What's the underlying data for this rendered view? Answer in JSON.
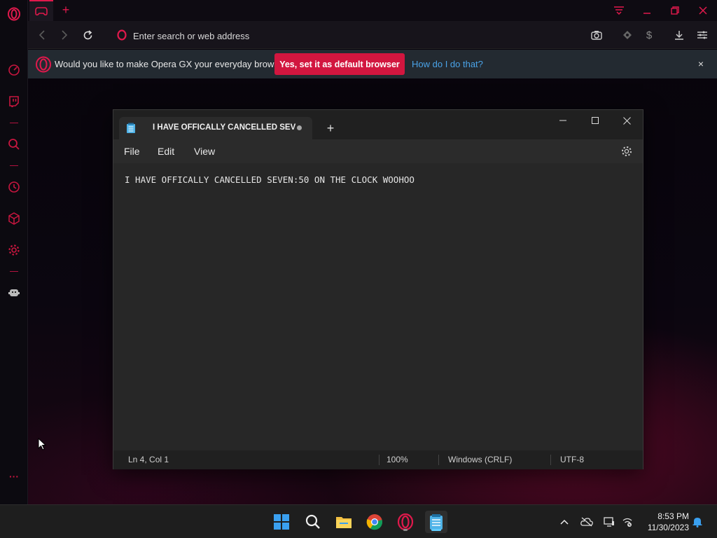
{
  "browser": {
    "address_placeholder": "Enter search or web address",
    "infobar": {
      "message": "Would you like to make Opera GX your everyday browser?",
      "yes_button": "Yes, set it as default browser",
      "how_link": "How do I do that?",
      "close": "×"
    },
    "new_tab": "+",
    "accent_color": "#e0194c"
  },
  "notepad": {
    "tab_title": "I HAVE OFFICALLY CANCELLED SEV",
    "new_tab": "+",
    "menu": [
      "File",
      "Edit",
      "View"
    ],
    "content": "I HAVE OFFICALLY CANCELLED SEVEN:50 ON THE CLOCK WOOHOO",
    "status": {
      "position": "Ln 4, Col 1",
      "zoom": "100%",
      "line_ending": "Windows (CRLF)",
      "encoding": "UTF-8"
    }
  },
  "taskbar": {
    "time": "8:53 PM",
    "date": "11/30/2023",
    "apps": [
      "start-icon",
      "search-icon",
      "file-explorer-icon",
      "chrome-icon",
      "opera-gx-icon",
      "notepad-icon"
    ]
  },
  "sidebar": {
    "more": "···"
  }
}
